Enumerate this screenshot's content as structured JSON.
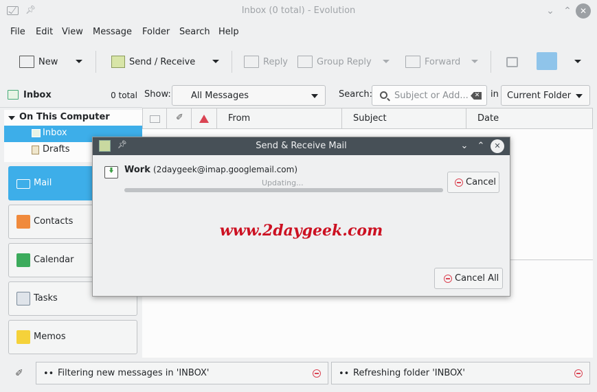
{
  "window": {
    "title": "Inbox (0 total) - Evolution"
  },
  "menu": [
    "File",
    "Edit",
    "View",
    "Message",
    "Folder",
    "Search",
    "Help"
  ],
  "toolbar": {
    "new_label": "New",
    "send_receive_label": "Send / Receive",
    "reply_label": "Reply",
    "group_reply_label": "Group Reply",
    "forward_label": "Forward"
  },
  "sidebar": {
    "folder_title": "Inbox",
    "folder_count": "0 total",
    "tree": {
      "root": "On This Computer",
      "items": [
        "Inbox",
        "Drafts"
      ]
    },
    "nav": [
      "Mail",
      "Contacts",
      "Calendar",
      "Tasks",
      "Memos"
    ]
  },
  "filter": {
    "show_label": "Show:",
    "show_value": "All Messages",
    "search_label": "Search:",
    "search_placeholder": "Subject or Add...",
    "in_label": "in",
    "scope_value": "Current Folder"
  },
  "columns": [
    "From",
    "Subject",
    "Date"
  ],
  "status": [
    {
      "text": "Filtering new messages in 'INBOX'"
    },
    {
      "text": "Refreshing folder 'INBOX'"
    }
  ],
  "dialog": {
    "title": "Send & Receive Mail",
    "account_name": "Work",
    "account_email": "(2daygeek@imap.googlemail.com)",
    "status": "Updating...",
    "progress": 1.0,
    "cancel_label": "Cancel",
    "cancel_all_label": "Cancel All",
    "watermark": "www.2daygeek.com"
  },
  "colors": {
    "accent": "#3daee9",
    "dialog_title": "#475057",
    "watermark": "#cc1122",
    "stop": "#da4453"
  }
}
